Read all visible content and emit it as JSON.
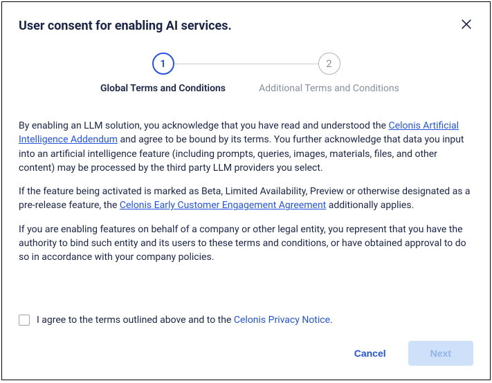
{
  "dialog": {
    "title": "User consent for enabling AI services."
  },
  "stepper": {
    "steps": [
      {
        "number": "1",
        "label": "Global Terms and Conditions"
      },
      {
        "number": "2",
        "label": "Additional Terms and Conditions"
      }
    ]
  },
  "content": {
    "p1_pre": "By enabling an LLM solution, you acknowledge that you have read and understood the ",
    "p1_link": "Celonis Artificial Intelligence Addendum",
    "p1_post": " and agree to be bound by its terms. You further acknowledge that data you input into an artificial intelligence feature (including prompts, queries, images, materials, files, and other content) may be processed by the third party LLM providers you select.",
    "p2_pre": "If the feature being activated is marked as Beta, Limited Availability, Preview or otherwise designated as a pre-release feature, the ",
    "p2_link": "Celonis Early Customer Engagement Agreement",
    "p2_post": " additionally applies.",
    "p3": "If you are enabling features on behalf of a company or other legal entity, you represent that you have the authority to bind such entity and its users to these terms and conditions, or have obtained approval to do so in accordance with your company policies."
  },
  "agree": {
    "label_pre": "I agree to the terms outlined above and to the ",
    "link": "Celonis Privacy Notice",
    "label_post": "."
  },
  "footer": {
    "cancel": "Cancel",
    "next": "Next"
  }
}
